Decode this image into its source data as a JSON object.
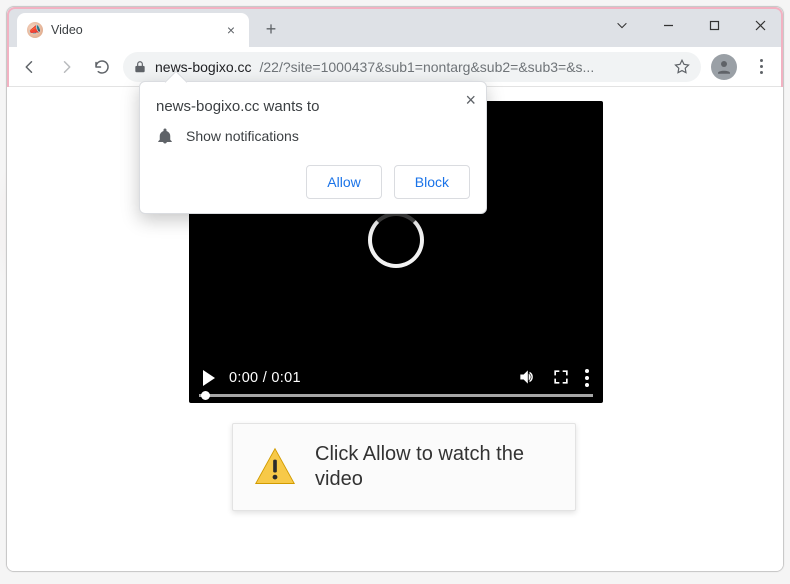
{
  "tab": {
    "title": "Video"
  },
  "address": {
    "host": "news-bogixo.cc",
    "path": "/22/?site=1000437&sub1=nontarg&sub2=&sub3=&s..."
  },
  "prompt": {
    "origin_line": "news-bogixo.cc wants to",
    "permission": "Show notifications",
    "allow": "Allow",
    "block": "Block"
  },
  "video": {
    "time": "0:00 / 0:01"
  },
  "instruction": {
    "text": "Click Allow to watch the video"
  }
}
